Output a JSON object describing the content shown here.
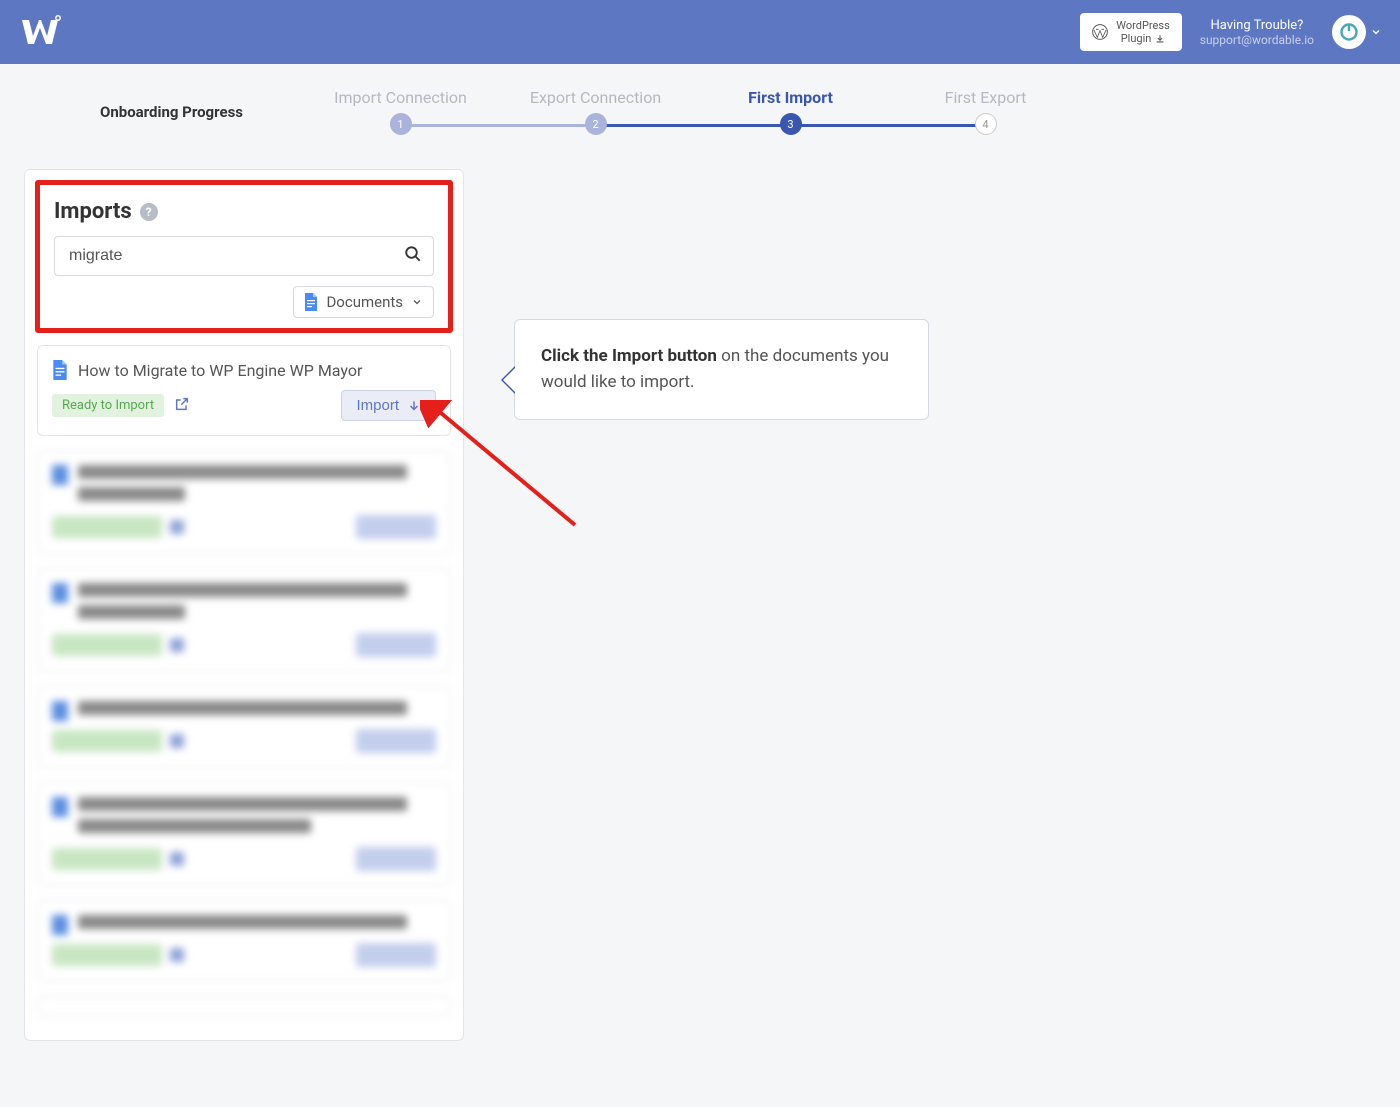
{
  "header": {
    "wp_plugin_line1": "WordPress",
    "wp_plugin_line2": "Plugin",
    "trouble_line1": "Having Trouble?",
    "trouble_line2": "support@wordable.io"
  },
  "progress": {
    "label": "Onboarding Progress",
    "steps": [
      {
        "label": "Import Connection",
        "num": "1",
        "state": "done"
      },
      {
        "label": "Export Connection",
        "num": "2",
        "state": "done"
      },
      {
        "label": "First Import",
        "num": "3",
        "state": "current"
      },
      {
        "label": "First Export",
        "num": "4",
        "state": "future"
      }
    ]
  },
  "imports": {
    "title": "Imports",
    "search_value": "migrate",
    "filter_label": "Documents",
    "doc": {
      "title": "How to Migrate to WP Engine WP Mayor",
      "ready_label": "Ready to Import",
      "import_btn": "Import"
    }
  },
  "tooltip": {
    "strong": "Click the Import button",
    "rest": " on the documents you would like to import."
  }
}
